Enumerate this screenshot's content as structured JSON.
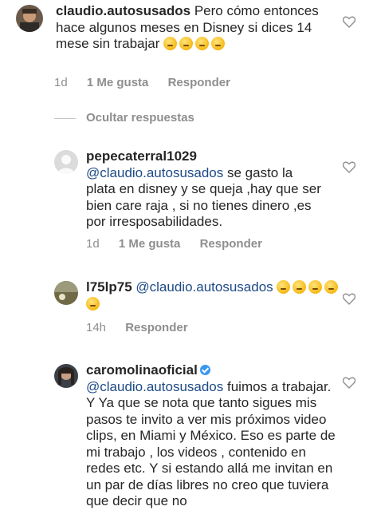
{
  "comments": [
    {
      "username": "claudio.autosusados",
      "text": "Pero cómo entonces hace algunos meses en Disney si dices 14 mese sin trabajar",
      "emoji_count": 4,
      "time": "1d",
      "likes": "1 Me gusta",
      "reply": "Responder"
    },
    {
      "username": "pepecaterral1029",
      "mention": "@claudio.autosusados",
      "text": "se gasto la plata en disney y se queja ,hay que ser bien care raja , si no tienes dinero ,es por irresposabilidades.",
      "time": "1d",
      "likes": "1 Me gusta",
      "reply": "Responder"
    },
    {
      "username": "l75lp75",
      "mention": "@claudio.autosusados",
      "emoji_count": 5,
      "time": "14h",
      "reply": "Responder"
    },
    {
      "username": "caromolinaoficial",
      "mention": "@claudio.autosusados",
      "text": "fuimos a trabajar. Y Ya que se nota que tanto sigues mis pasos te invito a ver mis próximos video clips, en Miami y México. Eso es parte de mi trabajo , los videos , contenido en redes etc. Y si estando allá me invitan en un par de días libres no creo que tuviera que decir que no"
    }
  ],
  "hide_replies_label": "Ocultar respuestas",
  "colors": {
    "text": "#262626",
    "meta": "#8e8e8e",
    "mention": "#1d4a86",
    "verified": "#3897f0"
  },
  "icons": [
    "heart-icon",
    "verified-badge-icon",
    "emoji-icon"
  ]
}
